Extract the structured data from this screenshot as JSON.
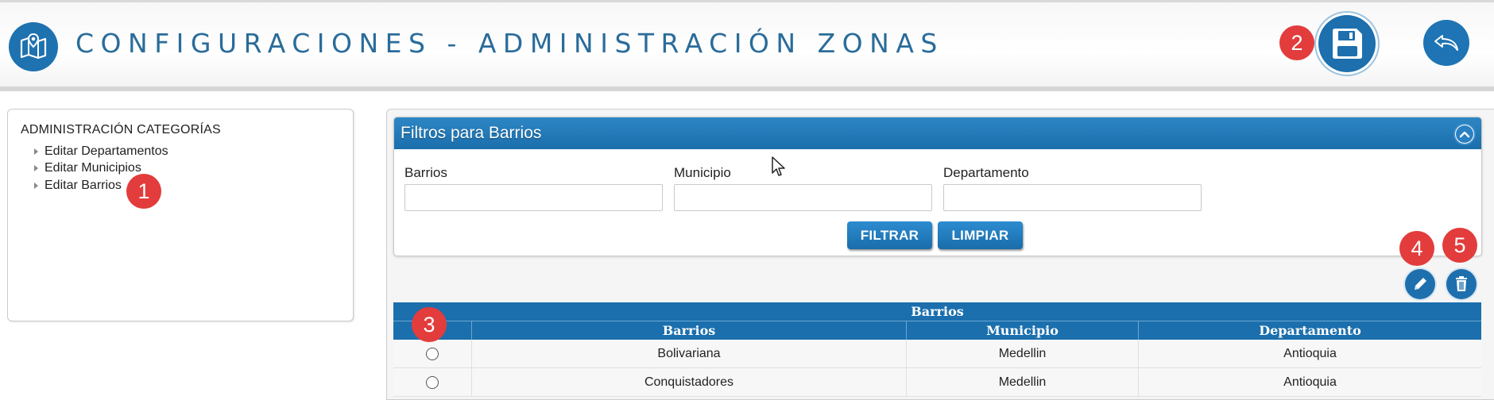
{
  "header": {
    "title": "CONFIGURACIONES - ADMINISTRACIÓN ZONAS",
    "logo_icon": "map-pin-icon",
    "save_icon": "floppy-disk-icon",
    "back_icon": "back-arrow-icon",
    "accent_color": "#1e72b0"
  },
  "badges": {
    "b1": "1",
    "b2": "2",
    "b3": "3",
    "b4": "4",
    "b5": "5"
  },
  "sidebar": {
    "title": "ADMINISTRACIÓN CATEGORÍAS",
    "items": [
      {
        "label": "Editar Departamentos"
      },
      {
        "label": "Editar Municipios"
      },
      {
        "label": "Editar Barrios"
      }
    ]
  },
  "filters": {
    "title": "Filtros para Barrios",
    "fields": [
      {
        "label": "Barrios",
        "value": ""
      },
      {
        "label": "Municipio",
        "value": ""
      },
      {
        "label": "Departamento",
        "value": ""
      }
    ],
    "filter_button": "FILTRAR",
    "clear_button": "LIMPIAR"
  },
  "grid": {
    "caption": "Barrios",
    "columns": [
      "",
      "Barrios",
      "Municipio",
      "Departamento"
    ],
    "rows": [
      {
        "barrio": "Bolivariana",
        "municipio": "Medellin",
        "departamento": "Antioquia"
      },
      {
        "barrio": "Conquistadores",
        "municipio": "Medellin",
        "departamento": "Antioquia"
      }
    ]
  }
}
